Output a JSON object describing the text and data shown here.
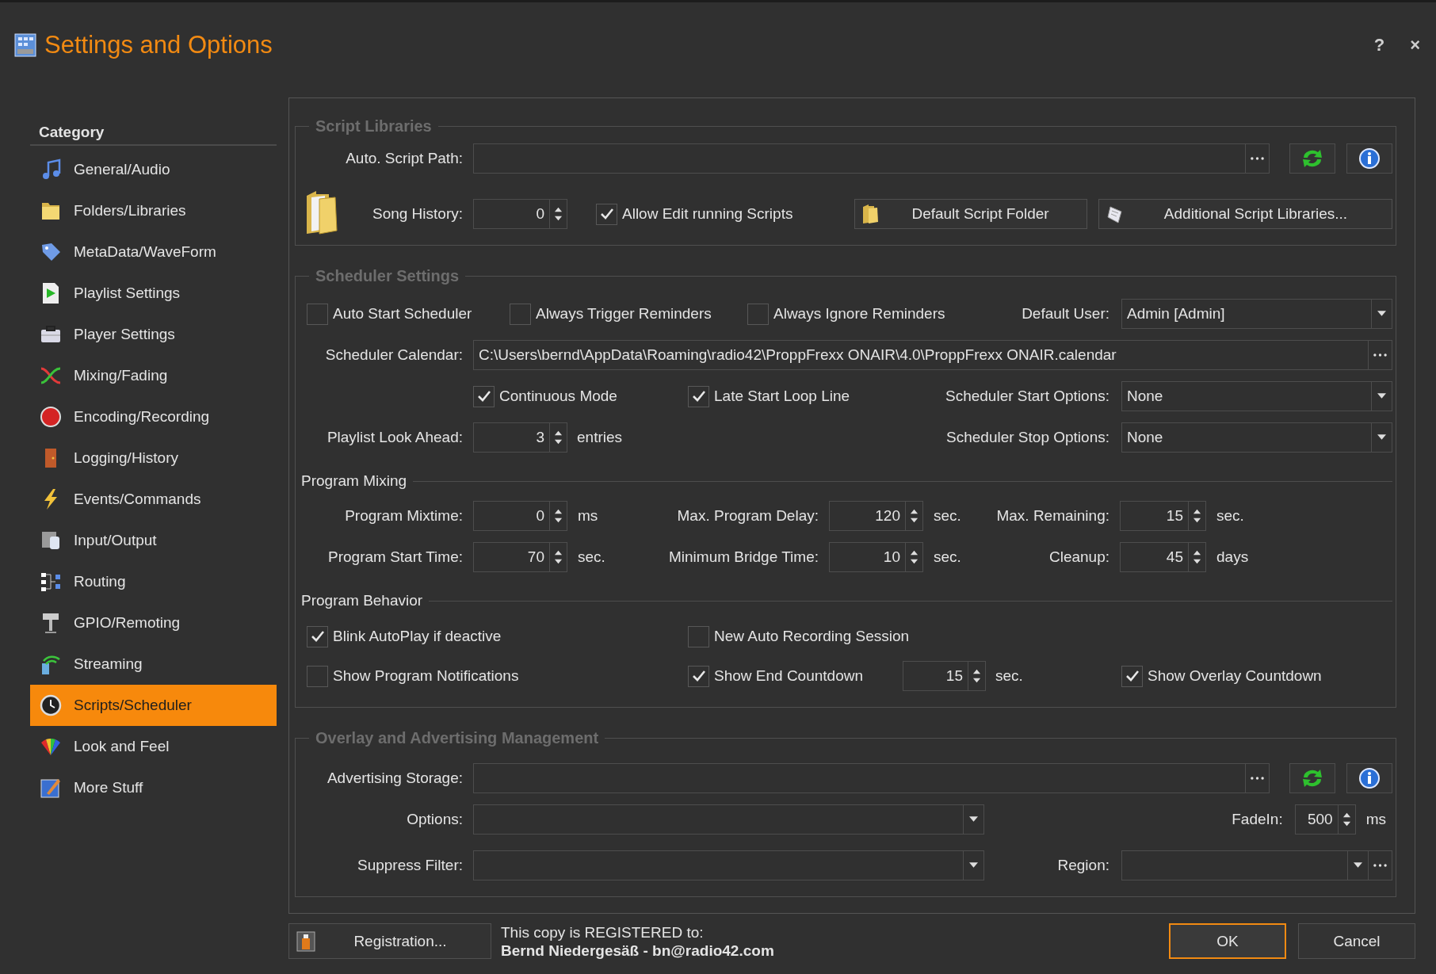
{
  "window": {
    "title": "Settings and Options",
    "help": "?",
    "close": "×"
  },
  "sidebar": {
    "heading": "Category",
    "items": [
      {
        "label": "General/Audio",
        "selected": false
      },
      {
        "label": "Folders/Libraries",
        "selected": false
      },
      {
        "label": "MetaData/WaveForm",
        "selected": false
      },
      {
        "label": "Playlist Settings",
        "selected": false
      },
      {
        "label": "Player Settings",
        "selected": false
      },
      {
        "label": "Mixing/Fading",
        "selected": false
      },
      {
        "label": "Encoding/Recording",
        "selected": false
      },
      {
        "label": "Logging/History",
        "selected": false
      },
      {
        "label": "Events/Commands",
        "selected": false
      },
      {
        "label": "Input/Output",
        "selected": false
      },
      {
        "label": "Routing",
        "selected": false
      },
      {
        "label": "GPIO/Remoting",
        "selected": false
      },
      {
        "label": "Streaming",
        "selected": false
      },
      {
        "label": "Scripts/Scheduler",
        "selected": true
      },
      {
        "label": "Look and Feel",
        "selected": false
      },
      {
        "label": "More Stuff",
        "selected": false
      }
    ]
  },
  "script_libraries": {
    "title": "Script Libraries",
    "auto_script_path": {
      "label": "Auto. Script Path:"
    },
    "song_history": {
      "label": "Song History:",
      "value": "0"
    },
    "allow_edit": {
      "label": "Allow Edit running Scripts",
      "checked": true
    },
    "buttons": [
      "Default Script Folder",
      "Additional Script Libraries..."
    ]
  },
  "scheduler_settings": {
    "title": "Scheduler Settings",
    "checkboxes": [
      {
        "label": "Auto Start Scheduler",
        "checked": false
      },
      {
        "label": "Always Trigger Reminders",
        "checked": false
      },
      {
        "label": "Always Ignore Reminders",
        "checked": false
      }
    ],
    "default_user": {
      "label": "Default User:",
      "value": "Admin [Admin]"
    },
    "calendar": {
      "label": "Scheduler Calendar:",
      "value": "C:\\Users\\bernd\\AppData\\Roaming\\radio42\\ProppFrexx ONAIR\\4.0\\ProppFrexx ONAIR.calendar"
    },
    "modes": [
      {
        "label": "Continuous Mode",
        "checked": true
      },
      {
        "label": "Late Start Loop Line",
        "checked": true
      }
    ],
    "start_options": {
      "label": "Scheduler Start Options:",
      "value": "None"
    },
    "look_ahead": {
      "label": "Playlist Look Ahead:",
      "value": "3",
      "unit": "entries"
    },
    "stop_options": {
      "label": "Scheduler Stop Options:",
      "value": "None"
    },
    "program_mixing": {
      "title": "Program Mixing",
      "fields": [
        {
          "label": "Program Mixtime:",
          "value": "0",
          "unit": "ms"
        },
        {
          "label": "Max. Program Delay:",
          "value": "120",
          "unit": "sec."
        },
        {
          "label": "Max. Remaining:",
          "value": "15",
          "unit": "sec."
        },
        {
          "label": "Program Start Time:",
          "value": "70",
          "unit": "sec."
        },
        {
          "label": "Minimum Bridge Time:",
          "value": "10",
          "unit": "sec."
        },
        {
          "label": "Cleanup:",
          "value": "45",
          "unit": "days"
        }
      ]
    },
    "program_behavior": {
      "title": "Program Behavior",
      "options": [
        {
          "label": "Blink AutoPlay if deactive",
          "checked": true
        },
        {
          "label": "New Auto Recording Session",
          "checked": false
        },
        {
          "label": "Show Program Notifications",
          "checked": false
        },
        {
          "label": "Show End Countdown",
          "checked": true,
          "value": "15",
          "unit": "sec."
        },
        {
          "label": "Show Overlay Countdown",
          "checked": true
        }
      ]
    }
  },
  "overlay_advertising": {
    "title": "Overlay and Advertising Management",
    "storage_label": "Advertising Storage:",
    "options_label": "Options:",
    "fadein": {
      "label": "FadeIn:",
      "value": "500",
      "unit": "ms"
    },
    "suppress_label": "Suppress Filter:",
    "region_label": "Region:"
  },
  "footer": {
    "registration": "Registration...",
    "registered_to": "This copy is REGISTERED to:",
    "owner": "Bernd Niedergesäß - bn@radio42.com",
    "buttons": [
      {
        "label": "OK",
        "default": true
      },
      {
        "label": "Cancel",
        "default": false
      }
    ]
  }
}
